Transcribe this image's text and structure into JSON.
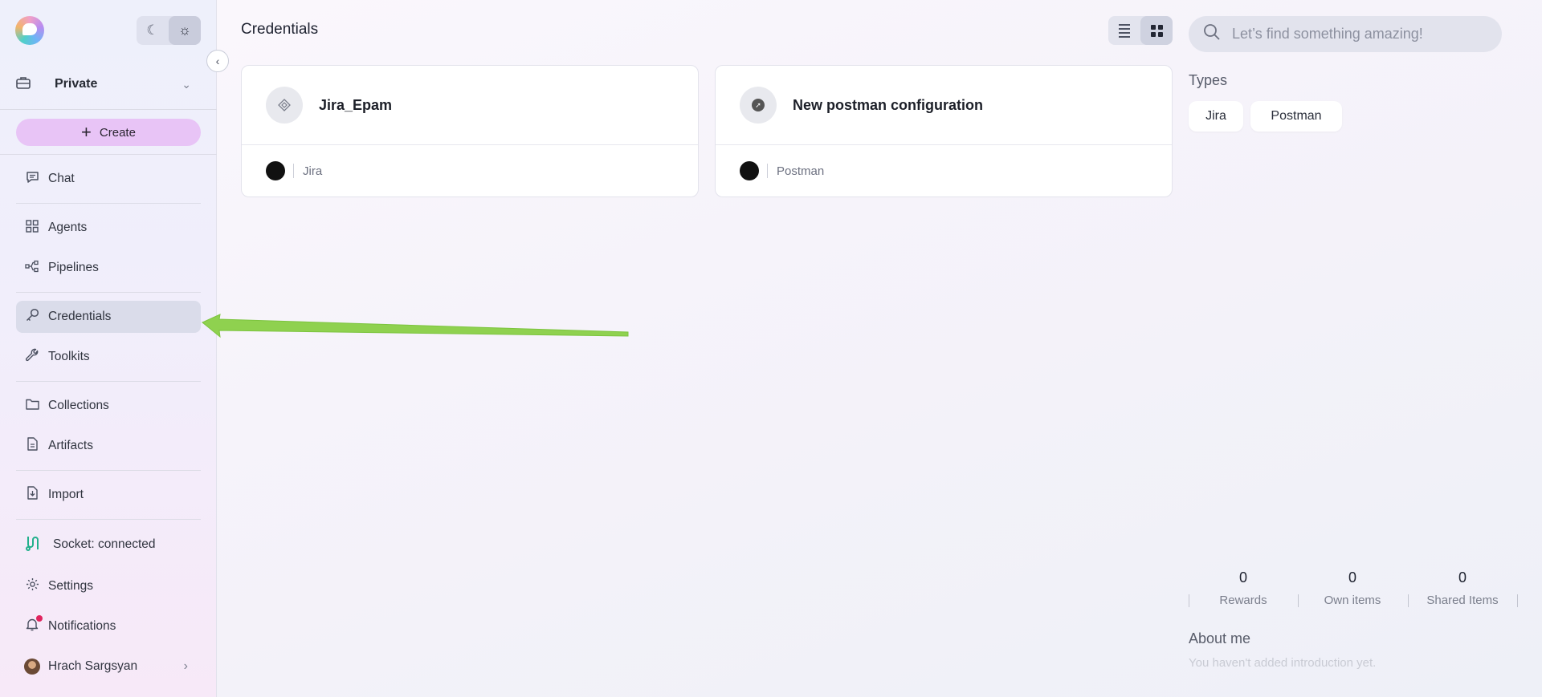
{
  "sidebar": {
    "workspace_label": "Private",
    "create_label": "Create",
    "items": {
      "chat": "Chat",
      "agents": "Agents",
      "pipelines": "Pipelines",
      "credentials": "Credentials",
      "toolkits": "Toolkits",
      "collections": "Collections",
      "artifacts": "Artifacts",
      "import": "Import",
      "socket": "Socket: connected",
      "settings": "Settings",
      "notifications": "Notifications",
      "user": "Hrach Sargsyan"
    },
    "active_item": "Credentials"
  },
  "header": {
    "title": "Credentials",
    "search_placeholder": "Let’s find something amazing!"
  },
  "cards": [
    {
      "title": "Jira_Epam",
      "type": "Jira"
    },
    {
      "title": "New postman configuration",
      "type": "Postman"
    }
  ],
  "right_panel": {
    "types_title": "Types",
    "types": [
      "Jira",
      "Postman"
    ],
    "stats": [
      {
        "value": "0",
        "label": "Rewards"
      },
      {
        "value": "0",
        "label": "Own items"
      },
      {
        "value": "0",
        "label": "Shared Items"
      }
    ],
    "about_title": "About me",
    "about_text": "You haven't added introduction yet."
  },
  "colors": {
    "create_button": "#e8c4f6",
    "annotation_arrow": "#8fd14f",
    "socket_icon": "#22b08c",
    "notification_dot": "#e0245e"
  }
}
